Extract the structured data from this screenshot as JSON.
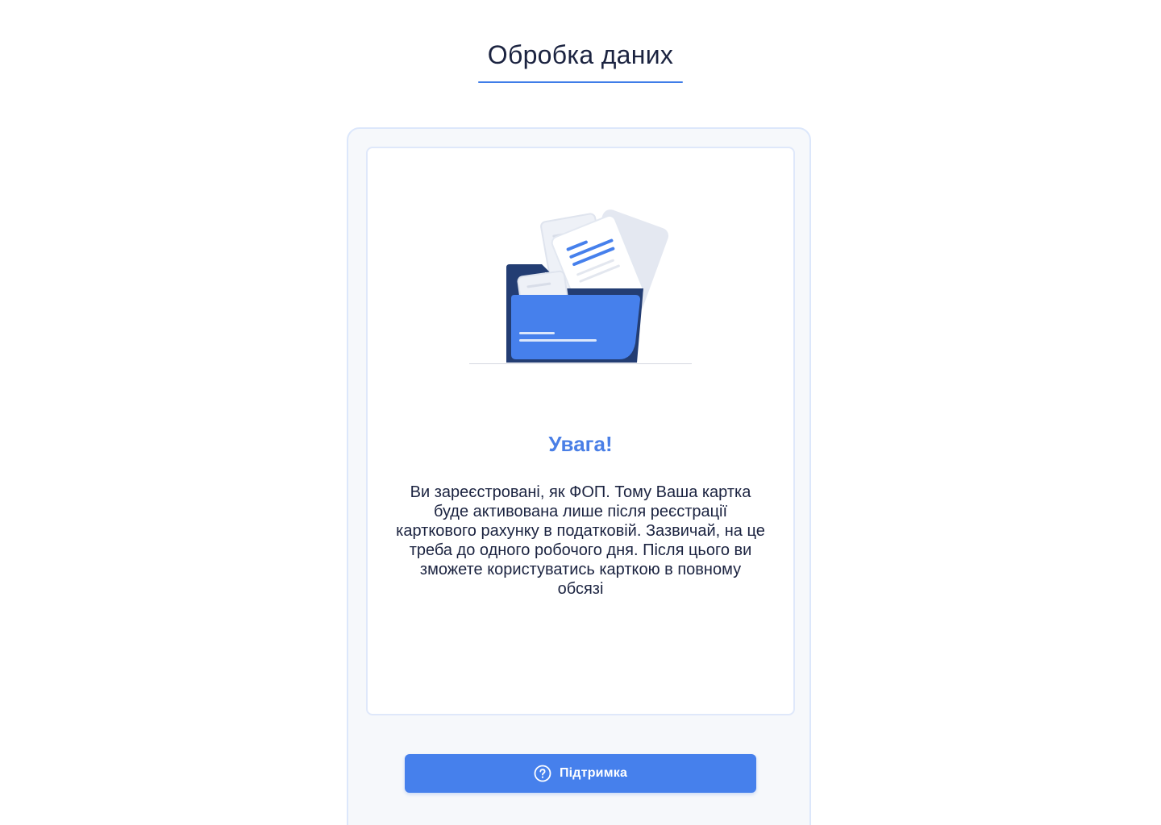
{
  "header": {
    "title": "Обробка даних"
  },
  "notice": {
    "illustration_icon": "folder-documents-icon",
    "title": "Увага!",
    "text": "Ви зареєстровані, як ФОП. Тому Ваша картка буде активована лише після реєстрації карткового рахунку в податковій. Зазвичай, на це треба до одного робочого дня. Після цього ви зможете користуватись карткою в повному обсязі"
  },
  "support_button": {
    "label": "Підтримка",
    "icon": "question-circle-icon"
  },
  "colors": {
    "accent": "#4680ec",
    "title_accent": "#4a7fe6",
    "folder_dark": "#233d73",
    "text_dark": "#1b2340",
    "panel_bg": "#f6f8fb",
    "panel_border": "#dce7fb"
  }
}
